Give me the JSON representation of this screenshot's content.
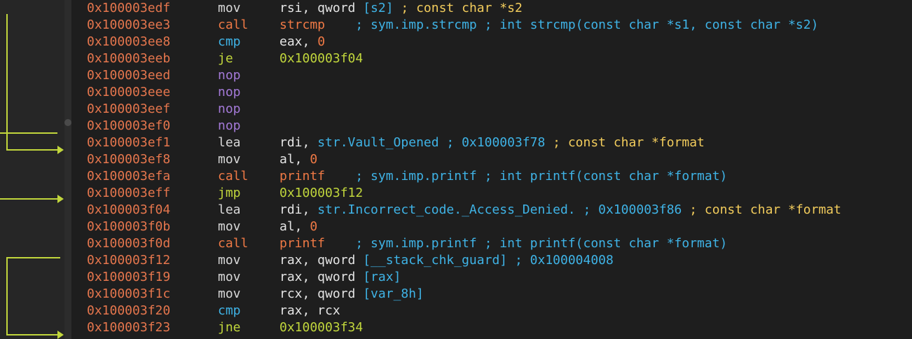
{
  "rows": [
    {
      "addr": "0x100003edf",
      "mnemonic": "mov",
      "kind": "mov",
      "operands": [
        {
          "t": "rsi, qword ",
          "c": "plain"
        },
        {
          "t": "[s2]",
          "c": "mem"
        },
        {
          "t": " ; const char *s2",
          "c": "ctype"
        }
      ]
    },
    {
      "addr": "0x100003ee3",
      "mnemonic": "call",
      "kind": "call",
      "operands": [
        {
          "t": "strcmp",
          "c": "fn"
        },
        {
          "t": "    ; sym.imp.strcmp ; int strcmp(const char *s1, const char *s2)",
          "c": "cmt"
        }
      ]
    },
    {
      "addr": "0x100003ee8",
      "mnemonic": "cmp",
      "kind": "cmp",
      "operands": [
        {
          "t": "eax, ",
          "c": "plain"
        },
        {
          "t": "0",
          "c": "num"
        }
      ]
    },
    {
      "addr": "0x100003eeb",
      "mnemonic": "je",
      "kind": "je",
      "operands": [
        {
          "t": "0x100003f04",
          "c": "jmpt"
        }
      ]
    },
    {
      "addr": "0x100003eed",
      "mnemonic": "nop",
      "kind": "nop",
      "operands": []
    },
    {
      "addr": "0x100003eee",
      "mnemonic": "nop",
      "kind": "nop",
      "operands": []
    },
    {
      "addr": "0x100003eef",
      "mnemonic": "nop",
      "kind": "nop",
      "operands": []
    },
    {
      "addr": "0x100003ef0",
      "mnemonic": "nop",
      "kind": "nop",
      "operands": []
    },
    {
      "addr": "0x100003ef1",
      "mnemonic": "lea",
      "kind": "lea",
      "operands": [
        {
          "t": "rdi, ",
          "c": "plain"
        },
        {
          "t": "str.Vault_Opened",
          "c": "str"
        },
        {
          "t": " ; ",
          "c": "cmt"
        },
        {
          "t": "0x100003f78",
          "c": "hex"
        },
        {
          "t": " ; const char *format",
          "c": "ctype"
        }
      ]
    },
    {
      "addr": "0x100003ef8",
      "mnemonic": "mov",
      "kind": "mov",
      "operands": [
        {
          "t": "al, ",
          "c": "plain"
        },
        {
          "t": "0",
          "c": "num"
        }
      ]
    },
    {
      "addr": "0x100003efa",
      "mnemonic": "call",
      "kind": "call",
      "operands": [
        {
          "t": "printf",
          "c": "fn"
        },
        {
          "t": "    ; sym.imp.printf ; int printf(const char *format)",
          "c": "cmt"
        }
      ]
    },
    {
      "addr": "0x100003eff",
      "mnemonic": "jmp",
      "kind": "jmp",
      "operands": [
        {
          "t": "0x100003f12",
          "c": "jmpt"
        }
      ]
    },
    {
      "addr": "0x100003f04",
      "mnemonic": "lea",
      "kind": "lea",
      "operands": [
        {
          "t": "rdi, ",
          "c": "plain"
        },
        {
          "t": "str.Incorrect_code._Access_Denied.",
          "c": "str"
        },
        {
          "t": " ; ",
          "c": "cmt"
        },
        {
          "t": "0x100003f86",
          "c": "hex"
        },
        {
          "t": " ; const char *format",
          "c": "ctype"
        }
      ]
    },
    {
      "addr": "0x100003f0b",
      "mnemonic": "mov",
      "kind": "mov",
      "operands": [
        {
          "t": "al, ",
          "c": "plain"
        },
        {
          "t": "0",
          "c": "num"
        }
      ]
    },
    {
      "addr": "0x100003f0d",
      "mnemonic": "call",
      "kind": "call",
      "operands": [
        {
          "t": "printf",
          "c": "fn"
        },
        {
          "t": "    ; sym.imp.printf ; int printf(const char *format)",
          "c": "cmt"
        }
      ]
    },
    {
      "addr": "0x100003f12",
      "mnemonic": "mov",
      "kind": "mov",
      "operands": [
        {
          "t": "rax, qword ",
          "c": "plain"
        },
        {
          "t": "[__stack_chk_guard]",
          "c": "mem"
        },
        {
          "t": " ; ",
          "c": "cmt"
        },
        {
          "t": "0x100004008",
          "c": "hex"
        }
      ]
    },
    {
      "addr": "0x100003f19",
      "mnemonic": "mov",
      "kind": "mov",
      "operands": [
        {
          "t": "rax, qword ",
          "c": "plain"
        },
        {
          "t": "[rax]",
          "c": "mem"
        }
      ]
    },
    {
      "addr": "0x100003f1c",
      "mnemonic": "mov",
      "kind": "mov",
      "operands": [
        {
          "t": "rcx, qword ",
          "c": "plain"
        },
        {
          "t": "[var_8h]",
          "c": "mem"
        }
      ]
    },
    {
      "addr": "0x100003f20",
      "mnemonic": "cmp",
      "kind": "cmp",
      "operands": [
        {
          "t": "rax, rcx",
          "c": "plain"
        }
      ]
    },
    {
      "addr": "0x100003f23",
      "mnemonic": "jne",
      "kind": "jne",
      "operands": [
        {
          "t": "0x100003f34",
          "c": "jmpt"
        }
      ]
    }
  ],
  "colors": {
    "background": "#1e1e1e",
    "gutter": "#262626",
    "address": "#e5764d",
    "arrow": "#c1d63c"
  },
  "icons": [
    "arrow-right-icon"
  ]
}
